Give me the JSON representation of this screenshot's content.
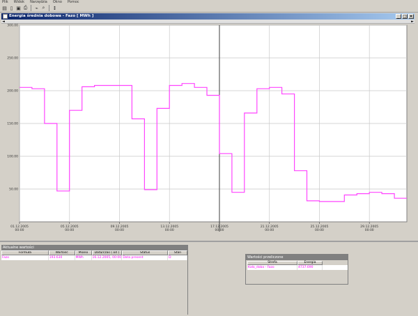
{
  "menu": [
    "Plik",
    "Widok",
    "Narzędzia",
    "Okno",
    "Pomoc"
  ],
  "toolbar": {
    "icons": [
      "open-icon",
      "new-icon",
      "print-preview-icon",
      "print-icon",
      "chart-type-icon",
      "zoom-icon",
      "cursor-icon"
    ]
  },
  "window": {
    "title": "Energia średnia dobowa - Fazo [ MWh ]",
    "minimize": "_",
    "maximize": "□",
    "close": "×"
  },
  "scroll": {
    "left": "◄",
    "right": "►"
  },
  "chart_data": {
    "type": "line",
    "step": true,
    "ylim": [
      0,
      300
    ],
    "yticks": [
      "300.00",
      "250.00",
      "200.00",
      "150.00",
      "100.00",
      "50.00"
    ],
    "xticks": [
      {
        "date": "01.12.2005",
        "time": "00:00"
      },
      {
        "date": "05.12.2005",
        "time": "00:00"
      },
      {
        "date": "09.12.2005",
        "time": "00:00"
      },
      {
        "date": "13.12.2005",
        "time": "00:00"
      },
      {
        "date": "17.12.2005",
        "time": "00:00"
      },
      {
        "date": "21.12.2005",
        "time": "00:00"
      },
      {
        "date": "25.12.2005",
        "time": "00:00"
      },
      {
        "date": "29.12.2005",
        "time": "00:00"
      }
    ],
    "x": [
      "01.12.2005",
      "02.12.2005",
      "03.12.2005",
      "04.12.2005",
      "05.12.2005",
      "06.12.2005",
      "07.12.2005",
      "08.12.2005",
      "09.12.2005",
      "10.12.2005",
      "11.12.2005",
      "12.12.2005",
      "13.12.2005",
      "14.12.2005",
      "15.12.2005",
      "16.12.2005",
      "17.12.2005",
      "18.12.2005",
      "19.12.2005",
      "20.12.2005",
      "21.12.2005",
      "22.12.2005",
      "23.12.2005",
      "24.12.2005",
      "25.12.2005",
      "26.12.2005",
      "27.12.2005",
      "28.12.2005",
      "29.12.2005",
      "30.12.2005",
      "31.12.2005"
    ],
    "values": [
      205,
      203,
      150,
      47,
      170,
      206,
      208,
      208,
      208,
      157,
      49,
      173,
      208,
      211,
      205,
      193,
      104,
      45,
      166,
      203,
      205,
      195,
      78,
      32,
      31,
      31,
      41,
      43,
      45,
      43,
      36
    ],
    "cursor_x": "17.12.2005",
    "line_color": "#ff44ff",
    "grid": true
  },
  "current_values": {
    "title": "Aktualne wartości",
    "columns": [
      "Formuła",
      "Wartość",
      "Miano",
      "Data/czas ( od )",
      "Status",
      "Stan"
    ],
    "rows": [
      [
        "Fazo",
        "193.630",
        "MWh",
        "16.12.2005, 00:00:00",
        "Data present",
        "D"
      ]
    ]
  },
  "calculated_values": {
    "title": "Wartości przeliczone",
    "columns": [
      "Strefa",
      "Energia"
    ],
    "rows": [
      [
        "Kała_doba - Fazo",
        "4737.690"
      ]
    ]
  }
}
